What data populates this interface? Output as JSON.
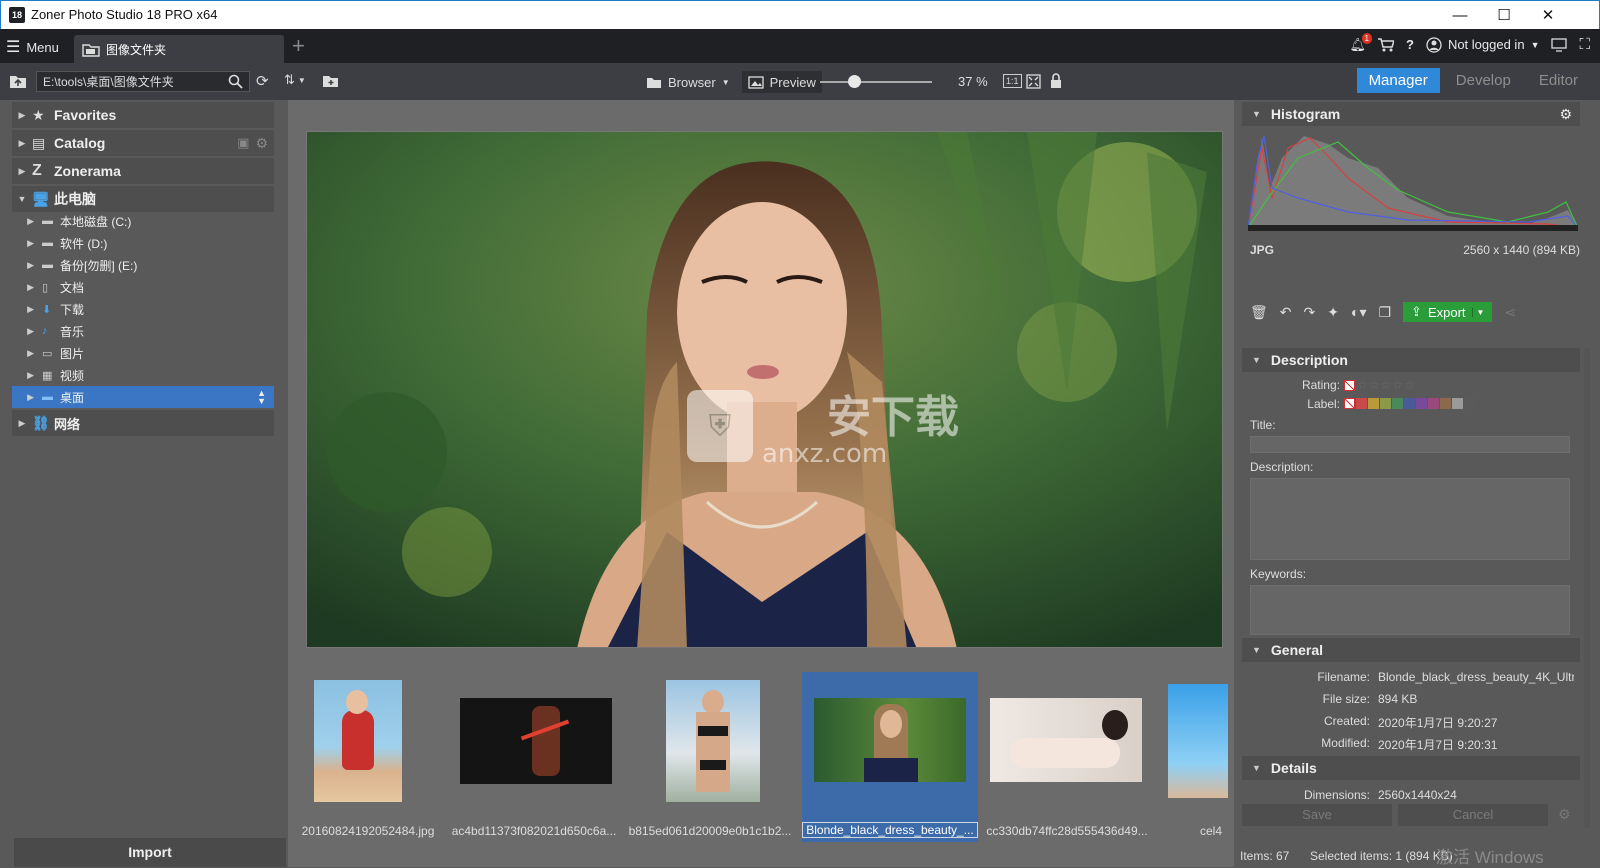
{
  "window": {
    "title": "Zoner Photo Studio 18 PRO x64",
    "app_icon": "18",
    "minimize": "—",
    "maximize": "☐",
    "close": "✕"
  },
  "tabbar": {
    "menu_label": "Menu",
    "tab_label": "图像文件夹",
    "add_tab": "+",
    "notification_count": "1",
    "login_label": "Not logged in"
  },
  "toolbar": {
    "path": "E:\\tools\\桌面\\图像文件夹",
    "browser_label": "Browser",
    "preview_label": "Preview",
    "zoom_value": 0.3,
    "zoom_label": "37 %",
    "ratio_btn": "1:1",
    "modes": [
      "Manager",
      "Develop",
      "Editor"
    ]
  },
  "sidebar": {
    "top_items": [
      {
        "label": "Favorites",
        "icon": "star-icon"
      },
      {
        "label": "Catalog",
        "icon": "catalog-icon"
      },
      {
        "label": "Zonerama",
        "icon": "zonerama-icon"
      },
      {
        "label": "此电脑",
        "icon": "computer-icon"
      }
    ],
    "drives": [
      {
        "label": "本地磁盘 (C:)"
      },
      {
        "label": "软件 (D:)"
      },
      {
        "label": "备份[勿删] (E:)"
      },
      {
        "label": "文档"
      },
      {
        "label": "下载"
      },
      {
        "label": "音乐"
      },
      {
        "label": "图片"
      },
      {
        "label": "视频"
      },
      {
        "label": "桌面"
      }
    ],
    "network": "网络",
    "import": "Import"
  },
  "filmstrip": [
    {
      "caption": "20160824192052484.jpg",
      "colors": [
        "#87b7d6",
        "#c8453e",
        "#d9b28e"
      ]
    },
    {
      "caption": "ac4bd11373f082021d650c6a...",
      "colors": [
        "#111111",
        "#1a1a1a",
        "#7a3a28"
      ]
    },
    {
      "caption": "b815ed061d20009e0b1c1b2...",
      "colors": [
        "#8fb8d8",
        "#2a2a2a",
        "#cfa58a"
      ]
    },
    {
      "caption": "Blonde_black_dress_beauty_...",
      "colors": [
        "#2d5a35",
        "#8a6a4a",
        "#203050"
      ]
    },
    {
      "caption": "cc330db74ffc28d555436d49...",
      "colors": [
        "#e8e2dc",
        "#f2ece8",
        "#3a2a28"
      ]
    },
    {
      "caption": "cel4",
      "colors": [
        "#3aa0e8",
        "#8fd0f5",
        "#d9b99a"
      ]
    }
  ],
  "right_panel": {
    "histogram_title": "Histogram",
    "format": "JPG",
    "dims_size": "2560 x 1440 (894 KB)",
    "export_label": "Export",
    "description_title": "Description",
    "rating_label": "Rating:",
    "label_label": "Label:",
    "title_label": "Title:",
    "description_label": "Description:",
    "keywords_label": "Keywords:",
    "general_title": "General",
    "general": [
      {
        "k": "Filename:",
        "v": "Blonde_black_dress_beauty_4K_Ultr"
      },
      {
        "k": "File size:",
        "v": "894 KB"
      },
      {
        "k": "Created:",
        "v": "2020年1月7日 9:20:27"
      },
      {
        "k": "Modified:",
        "v": "2020年1月7日 9:20:31"
      }
    ],
    "details_title": "Details",
    "details": [
      {
        "k": "Dimensions:",
        "v": "2560x1440x24"
      }
    ],
    "save": "Save",
    "cancel": "Cancel",
    "label_colors": [
      "#c94a4a",
      "#b89a3a",
      "#8a9a4a",
      "#4a8a5a",
      "#4a5a9a",
      "#7a4a9a",
      "#9a4a7a",
      "#8a6a4a",
      "#9a9a9a",
      "#5a5a5a"
    ]
  },
  "status": {
    "items": "Items: 67",
    "selected": "Selected items: 1 (894 KB)"
  },
  "watermark": {
    "line1": "安下载",
    "line2": "anxz.com",
    "activate": "激活 Windows"
  }
}
